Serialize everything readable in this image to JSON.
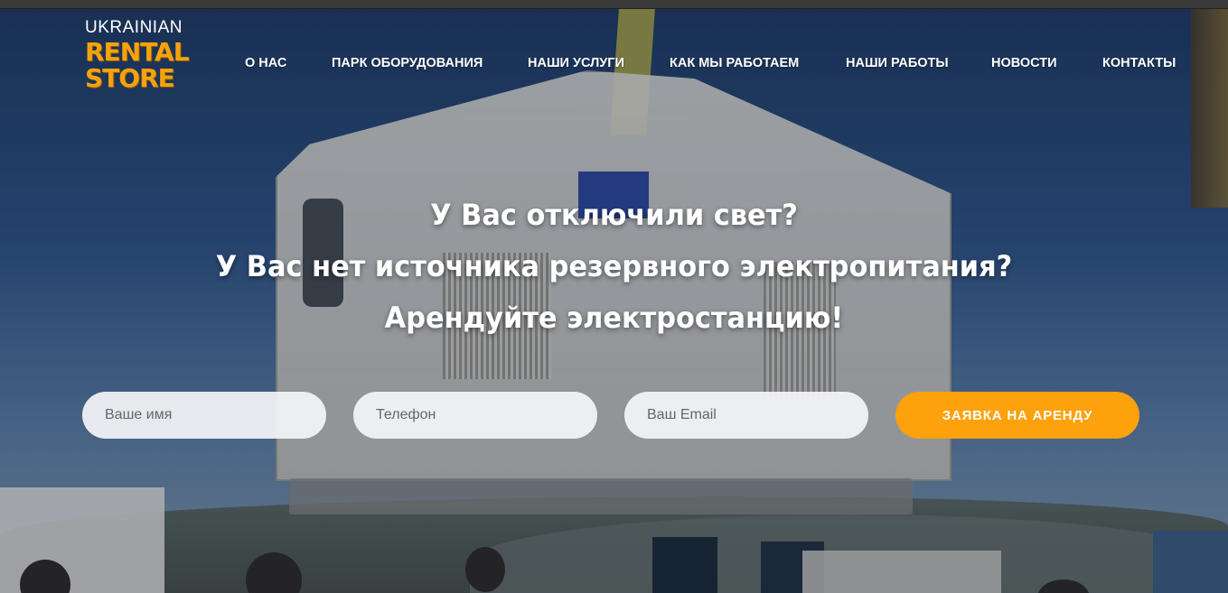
{
  "logo": {
    "top": "UKRAINIAN",
    "line1": "RENTAL",
    "line2": "STORE"
  },
  "nav": {
    "items": [
      {
        "label": "О НАС"
      },
      {
        "label": "ПАРК ОБОРУДОВАНИЯ"
      },
      {
        "label": "НАШИ УСЛУГИ"
      },
      {
        "label": "КАК МЫ РАБОТАЕМ"
      },
      {
        "label": "НАШИ РАБОТЫ"
      },
      {
        "label": "НОВОСТИ"
      },
      {
        "label": "КОНТАКТЫ"
      }
    ]
  },
  "hero": {
    "line1": "У Вас отключили свет?",
    "line2": "У Вас нет источника резервного электропитания?",
    "line3": "Арендуйте электростанцию!"
  },
  "form": {
    "name_placeholder": "Ваше имя",
    "phone_placeholder": "Телефон",
    "email_placeholder": "Ваш Email",
    "submit_label": "ЗАЯВКА НА АРЕНДУ"
  },
  "colors": {
    "accent": "#fda10d",
    "logo": "#f5a20e",
    "text": "#ffffff"
  }
}
